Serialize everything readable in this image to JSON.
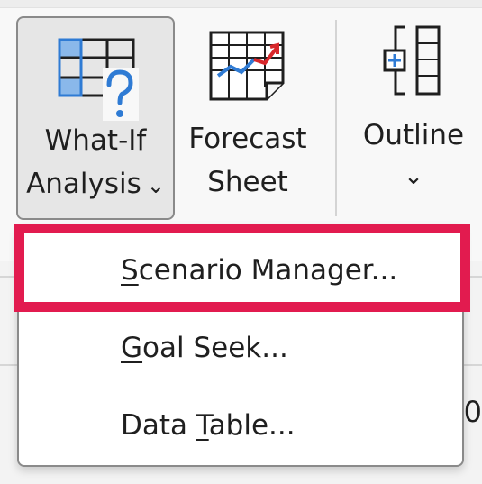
{
  "ribbon": {
    "what_if": {
      "line1": "What-If",
      "line2": "Analysis",
      "chevron": "⌄",
      "icon": "what-if-analysis-icon"
    },
    "forecast": {
      "line1": "Forecast",
      "line2": "Sheet",
      "icon": "forecast-sheet-icon"
    },
    "outline": {
      "line1": "Outline",
      "chevron": "⌄",
      "icon": "outline-icon"
    }
  },
  "menu": {
    "items": [
      {
        "prefix": "",
        "underline": "S",
        "rest": "cenario Manager..."
      },
      {
        "prefix": "",
        "underline": "G",
        "rest": "oal Seek..."
      },
      {
        "prefix": "Data ",
        "underline": "T",
        "rest": "able..."
      }
    ]
  },
  "background": {
    "partial_char": "0"
  },
  "colors": {
    "accent_blue": "#2f7bd4",
    "cell_fill": "#8ab8ea",
    "trend_red": "#d8272b",
    "trend_blue": "#2f7bd4",
    "highlight": "#e21b4f"
  }
}
